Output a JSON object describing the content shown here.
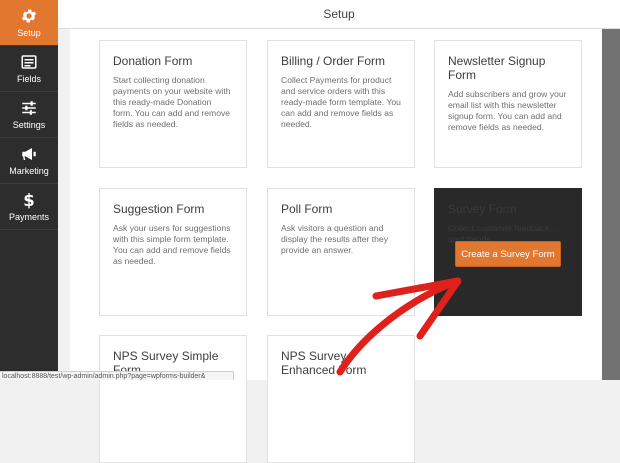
{
  "header": {
    "title": "Setup"
  },
  "sidebar": {
    "items": [
      {
        "label": "Setup",
        "icon": "gear-icon",
        "active": true
      },
      {
        "label": "Fields",
        "icon": "fields-list-icon"
      },
      {
        "label": "Settings",
        "icon": "sliders-icon"
      },
      {
        "label": "Marketing",
        "icon": "megaphone-icon"
      },
      {
        "label": "Payments",
        "icon": "dollar-icon"
      }
    ]
  },
  "templates": [
    {
      "title": "Donation Form",
      "description": "Start collecting donation payments on your website with this ready-made Donation form. You can add and remove fields as needed."
    },
    {
      "title": "Billing / Order Form",
      "description": "Collect Payments for product and service orders with this ready-made form template. You can add and remove fields as needed."
    },
    {
      "title": "Newsletter Signup Form",
      "description": "Add subscribers and grow your email list with this newsletter signup form. You can add and remove fields as needed."
    },
    {
      "title": "Suggestion Form",
      "description": "Ask your users for suggestions with this simple form template. You can add and remove fields as needed."
    },
    {
      "title": "Poll Form",
      "description": "Ask visitors a question and display the results after they provide an answer."
    },
    {
      "title": "Survey Form",
      "description": "Collect customer feedback, ... spot trends.",
      "button_label": "Create a Survey Form"
    },
    {
      "title": "NPS Survey Simple Form",
      "description": ""
    },
    {
      "title": "NPS Survey Enhanced Form",
      "description": ""
    }
  ],
  "status_bar": {
    "url": "localhost:8888/test/wp-admin/admin.php?page=wpforms-builder&"
  },
  "colors": {
    "accent": "#e27730",
    "sidebar_bg": "#2d2d2d",
    "arrow": "#e0201b"
  }
}
